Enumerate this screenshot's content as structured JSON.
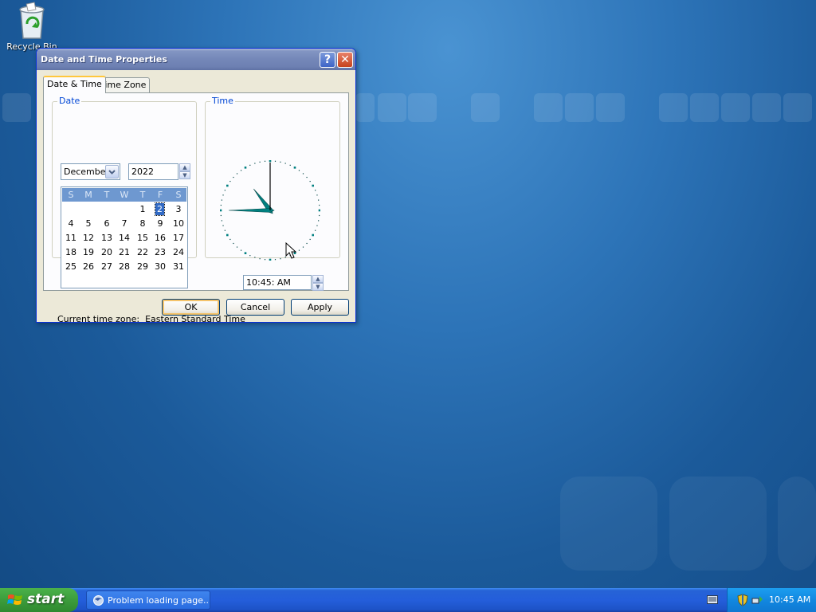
{
  "desktop": {
    "recycle_bin_label": "Recycle Bin"
  },
  "dialog": {
    "title": "Date and Time Properties",
    "help_glyph": "?",
    "close_glyph": "✕",
    "tabs": [
      {
        "label": "Date & Time",
        "active": true
      },
      {
        "label": "Time Zone",
        "active": false
      }
    ],
    "date_group": {
      "title": "Date",
      "month": "December",
      "year": "2022",
      "weekdays": [
        "S",
        "M",
        "T",
        "W",
        "T",
        "F",
        "S"
      ],
      "weeks": [
        [
          "",
          "",
          "",
          "",
          "1",
          "2",
          "3"
        ],
        [
          "4",
          "5",
          "6",
          "7",
          "8",
          "9",
          "10"
        ],
        [
          "11",
          "12",
          "13",
          "14",
          "15",
          "16",
          "17"
        ],
        [
          "18",
          "19",
          "20",
          "21",
          "22",
          "23",
          "24"
        ],
        [
          "25",
          "26",
          "27",
          "28",
          "29",
          "30",
          "31"
        ]
      ],
      "selected_day": "2"
    },
    "time_group": {
      "title": "Time",
      "time_value": "10:45:  AM",
      "clock_hours": 10,
      "clock_minutes": 45,
      "clock_seconds": 0
    },
    "current_timezone_label": "Current time zone:",
    "current_timezone_value": "Eastern Standard Time",
    "buttons": {
      "ok": "OK",
      "cancel": "Cancel",
      "apply": "Apply"
    }
  },
  "taskbar": {
    "start_label": "start",
    "task_button_label": "Problem loading page...",
    "clock": "10:45 AM"
  },
  "colors": {
    "titlebar": "#7487b8",
    "calendar_header": "#6e98d0",
    "selection": "#316ac5",
    "clock_hands": "#008080",
    "group_title": "#0046d5"
  }
}
